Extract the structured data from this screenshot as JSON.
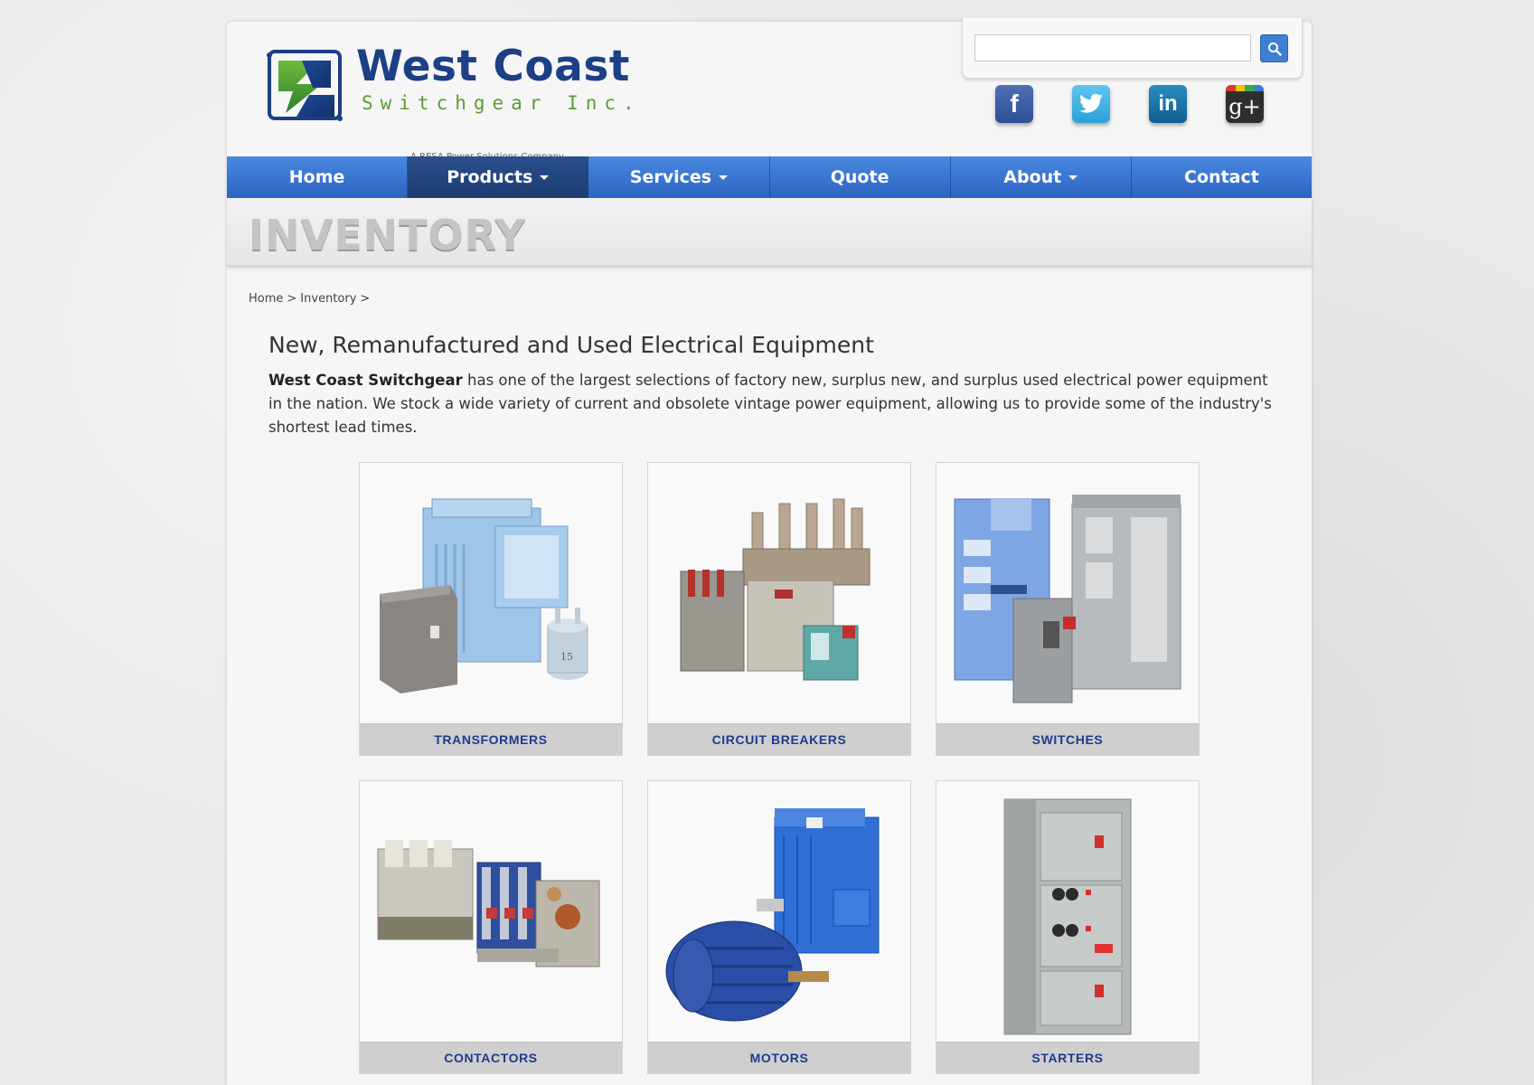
{
  "brand": {
    "name": "West Coast",
    "sub": "Switchgear Inc.",
    "tagline": "A RESA Power Solutions Company"
  },
  "search": {
    "placeholder": "",
    "value": ""
  },
  "social": {
    "facebook": "f",
    "twitter": "t",
    "linkedin": "in",
    "googleplus": "g+"
  },
  "nav": {
    "items": [
      {
        "label": "Home",
        "dropdown": false
      },
      {
        "label": "Products",
        "dropdown": true,
        "active": true
      },
      {
        "label": "Services",
        "dropdown": true
      },
      {
        "label": "Quote",
        "dropdown": false
      },
      {
        "label": "About",
        "dropdown": true
      },
      {
        "label": "Contact",
        "dropdown": false
      }
    ]
  },
  "page": {
    "banner_title": "INVENTORY",
    "breadcrumb": [
      "Home",
      ">",
      "Inventory",
      ">"
    ],
    "heading": "New, Remanufactured and Used Electrical Equipment",
    "intro_bold": "West Coast Switchgear",
    "intro_rest": " has one of the largest selections of factory new, surplus new, and surplus used electrical power equipment in the nation. We stock a wide variety of current and obsolete vintage power equipment, allowing us to provide some of the industry's shortest lead times."
  },
  "categories": [
    {
      "label": "TRANSFORMERS"
    },
    {
      "label": "CIRCUIT BREAKERS"
    },
    {
      "label": "SWITCHES"
    },
    {
      "label": "CONTACTORS"
    },
    {
      "label": "MOTORS"
    },
    {
      "label": "STARTERS"
    }
  ],
  "colors": {
    "nav_blue": "#3a76d4",
    "nav_active": "#244a85",
    "label_blue": "#1d3c8c",
    "logo_blue": "#1c3f86",
    "logo_green": "#5a9e2e"
  }
}
